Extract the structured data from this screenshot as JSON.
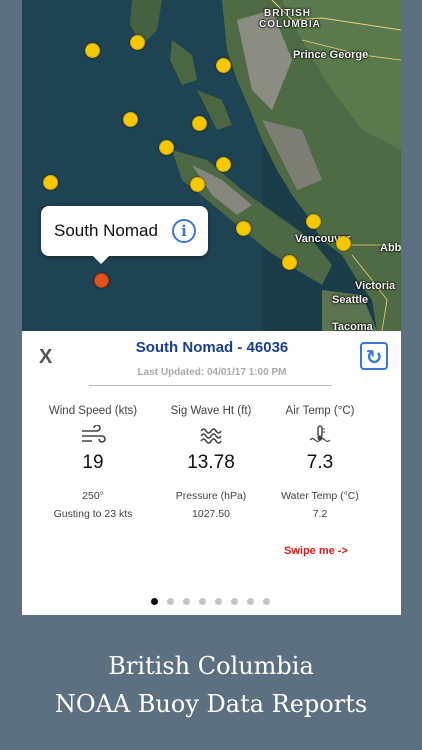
{
  "map": {
    "region_label": "BRITISH\nCOLUMBIA",
    "region_line1": "BRITISH",
    "region_line2": "COLUMBIA",
    "cities": {
      "prince_george": "Prince George",
      "vancouver": "Vancouver",
      "abb": "Abb",
      "victoria": "Victoria",
      "seattle": "Seattle",
      "tacoma": "Tacoma"
    },
    "buoy_color": "#f5c800",
    "selected_buoy_color": "#e0531d"
  },
  "callout": {
    "name": "South Nomad",
    "info_icon": "i"
  },
  "panel": {
    "close_label": "X",
    "station_title": "South Nomad - 46036",
    "last_updated": "Last Updated: 04/01/17 1:00 PM",
    "refresh_icon": "refresh-icon",
    "columns": [
      {
        "label": "Wind Speed (kts)",
        "icon": "wind-icon",
        "value": "19",
        "sub_label": "250°",
        "sub_value": "Gusting to 23 kts"
      },
      {
        "label": "Sig Wave Ht (ft)",
        "icon": "waves-icon",
        "value": "13.78",
        "sub_label": "Pressure (hPa)",
        "sub_value": "1027.50"
      },
      {
        "label": "Air Temp (°C)",
        "icon": "water-temp-icon",
        "value": "7.3",
        "sub_label": "Water Temp (°C)",
        "sub_value": "7.2"
      }
    ],
    "swipe_hint": "Swipe me ->",
    "page_count": 8,
    "active_page": 1,
    "accent_color": "#1a3f8f",
    "swipe_color": "#d91a1a"
  },
  "caption": {
    "line1": "British Columbia",
    "line2": "NOAA Buoy Data Reports"
  }
}
